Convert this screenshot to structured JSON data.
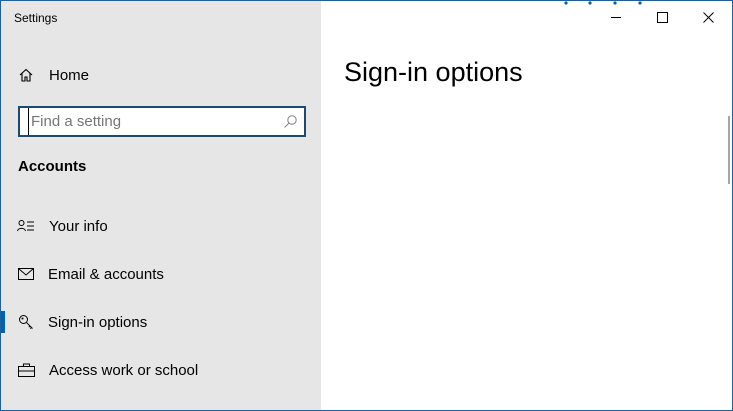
{
  "window": {
    "title": "Settings"
  },
  "titlebar": {
    "minimize_icon": "minimize-icon",
    "maximize_icon": "maximize-icon",
    "close_icon": "close-icon"
  },
  "sidebar": {
    "home_label": "Home",
    "home_icon": "home-icon",
    "search": {
      "value": "",
      "placeholder": "Find a setting",
      "icon": "search-icon"
    },
    "section_heading": "Accounts",
    "items": [
      {
        "label": "Your info",
        "icon": "person-card-icon",
        "active": false
      },
      {
        "label": "Email & accounts",
        "icon": "mail-icon",
        "active": false
      },
      {
        "label": "Sign-in options",
        "icon": "key-icon",
        "active": true
      },
      {
        "label": "Access work or school",
        "icon": "briefcase-icon",
        "active": false
      }
    ]
  },
  "main": {
    "page_title": "Sign-in options"
  },
  "colors": {
    "sidebar_bg": "#e6e6e6",
    "accent": "#0063b1",
    "search_border": "#1d4a6e",
    "window_border": "#1f5f9a"
  }
}
